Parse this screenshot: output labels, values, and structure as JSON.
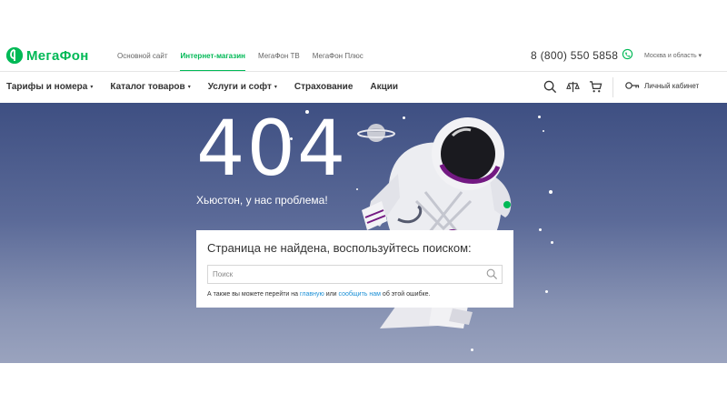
{
  "header": {
    "logo_text": "МегаФон",
    "logo_badge": "?",
    "nav": [
      {
        "label": "Основной сайт",
        "active": false
      },
      {
        "label": "Интернет-магазин",
        "active": true
      },
      {
        "label": "МегаФон ТВ",
        "active": false
      },
      {
        "label": "МегаФон Плюс",
        "active": false
      }
    ],
    "phone": "8 (800) 550 5858",
    "region": "Москва и область ▾"
  },
  "menu": {
    "items": [
      {
        "label": "Тарифы и номера",
        "caret": "▾"
      },
      {
        "label": "Каталог товаров",
        "caret": "▾"
      },
      {
        "label": "Услуги и софт",
        "caret": "▾"
      },
      {
        "label": "Страхование",
        "caret": ""
      },
      {
        "label": "Акции",
        "caret": ""
      }
    ],
    "icons": [
      "search-icon",
      "compare-icon",
      "cart-icon"
    ],
    "cabinet_label": "Личный кабинет"
  },
  "error": {
    "code": "404",
    "subtitle": "Хьюстон, у нас проблема!",
    "card_title": "Страница не найдена, воспользуйтесь поиском:",
    "search_placeholder": "Поиск",
    "hint_prefix": "А также вы можете перейти на",
    "hint_link1": "главную",
    "hint_middle": "или",
    "hint_link2": "сообщить нам",
    "hint_suffix": "об этой ошибке."
  },
  "colors": {
    "brand_green": "#00b956",
    "brand_purple": "#731982",
    "link_blue": "#1a8fd6",
    "hero_top": "#3e4f82",
    "hero_bottom": "#9aa3be"
  }
}
